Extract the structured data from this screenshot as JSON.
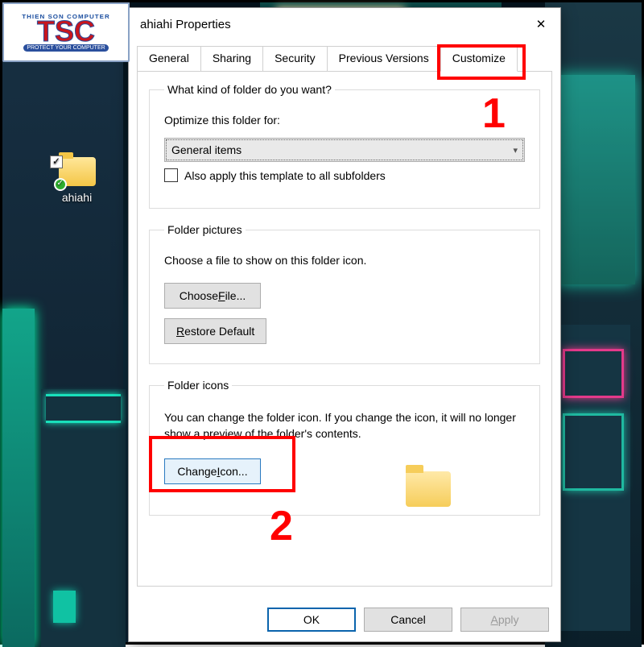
{
  "logo": {
    "arc": "THIEN SON COMPUTER",
    "tsc": "TSC",
    "sub": "PROTECT YOUR COMPUTER"
  },
  "desktop_item": {
    "label": "ahiahi",
    "checked": "✓"
  },
  "dialog": {
    "title": "ahiahi Properties",
    "tabs": {
      "general": "General",
      "sharing": "Sharing",
      "security": "Security",
      "previous": "Previous Versions",
      "customize": "Customize"
    },
    "group1": {
      "legend": "What kind of folder do you want?",
      "optimize_label": "Optimize this folder for:",
      "select_value": "General items",
      "subfolders": "Also apply this template to all subfolders"
    },
    "group2": {
      "legend": "Folder pictures",
      "desc": "Choose a file to show on this folder icon.",
      "choose_pre": "Choose ",
      "choose_u": "F",
      "choose_post": "ile...",
      "restore_u": "R",
      "restore_post": "estore Default"
    },
    "group3": {
      "legend": "Folder icons",
      "desc": "You can change the folder icon. If you change the icon, it will no longer show a preview of the folder's contents.",
      "change_pre": "Change ",
      "change_u": "I",
      "change_post": "con..."
    },
    "buttons": {
      "ok": "OK",
      "cancel": "Cancel",
      "apply_u": "A",
      "apply_post": "pply"
    }
  },
  "annotations": {
    "one": "1",
    "two": "2"
  }
}
